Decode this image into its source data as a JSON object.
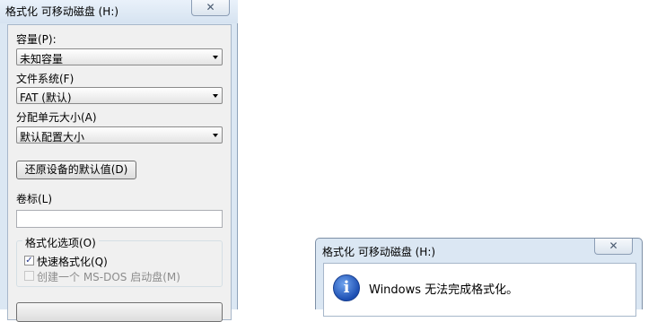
{
  "format_dialog": {
    "title": "格式化 可移动磁盘 (H:)",
    "close_label": "✕",
    "capacity": {
      "label": "容量(P):",
      "value": "未知容量"
    },
    "filesystem": {
      "label": "文件系统(F)",
      "value": "FAT (默认)"
    },
    "allocation": {
      "label": "分配单元大小(A)",
      "value": "默认配置大小"
    },
    "restore_defaults_label": "还原设备的默认值(D)",
    "volume_label": {
      "label": "卷标(L)",
      "value": ""
    },
    "options": {
      "title": "格式化选项(O)",
      "quick_format": {
        "label": "快速格式化(Q)",
        "checked": true,
        "check_mark": "✓"
      },
      "msdos_startup": {
        "label": "创建一个 MS-DOS 启动盘(M)",
        "checked": false,
        "enabled": false
      }
    }
  },
  "error_dialog": {
    "title": "格式化 可移动磁盘 (H:)",
    "close_label": "✕",
    "icon": "information-icon",
    "icon_glyph": "i",
    "message": "Windows 无法完成格式化。"
  }
}
